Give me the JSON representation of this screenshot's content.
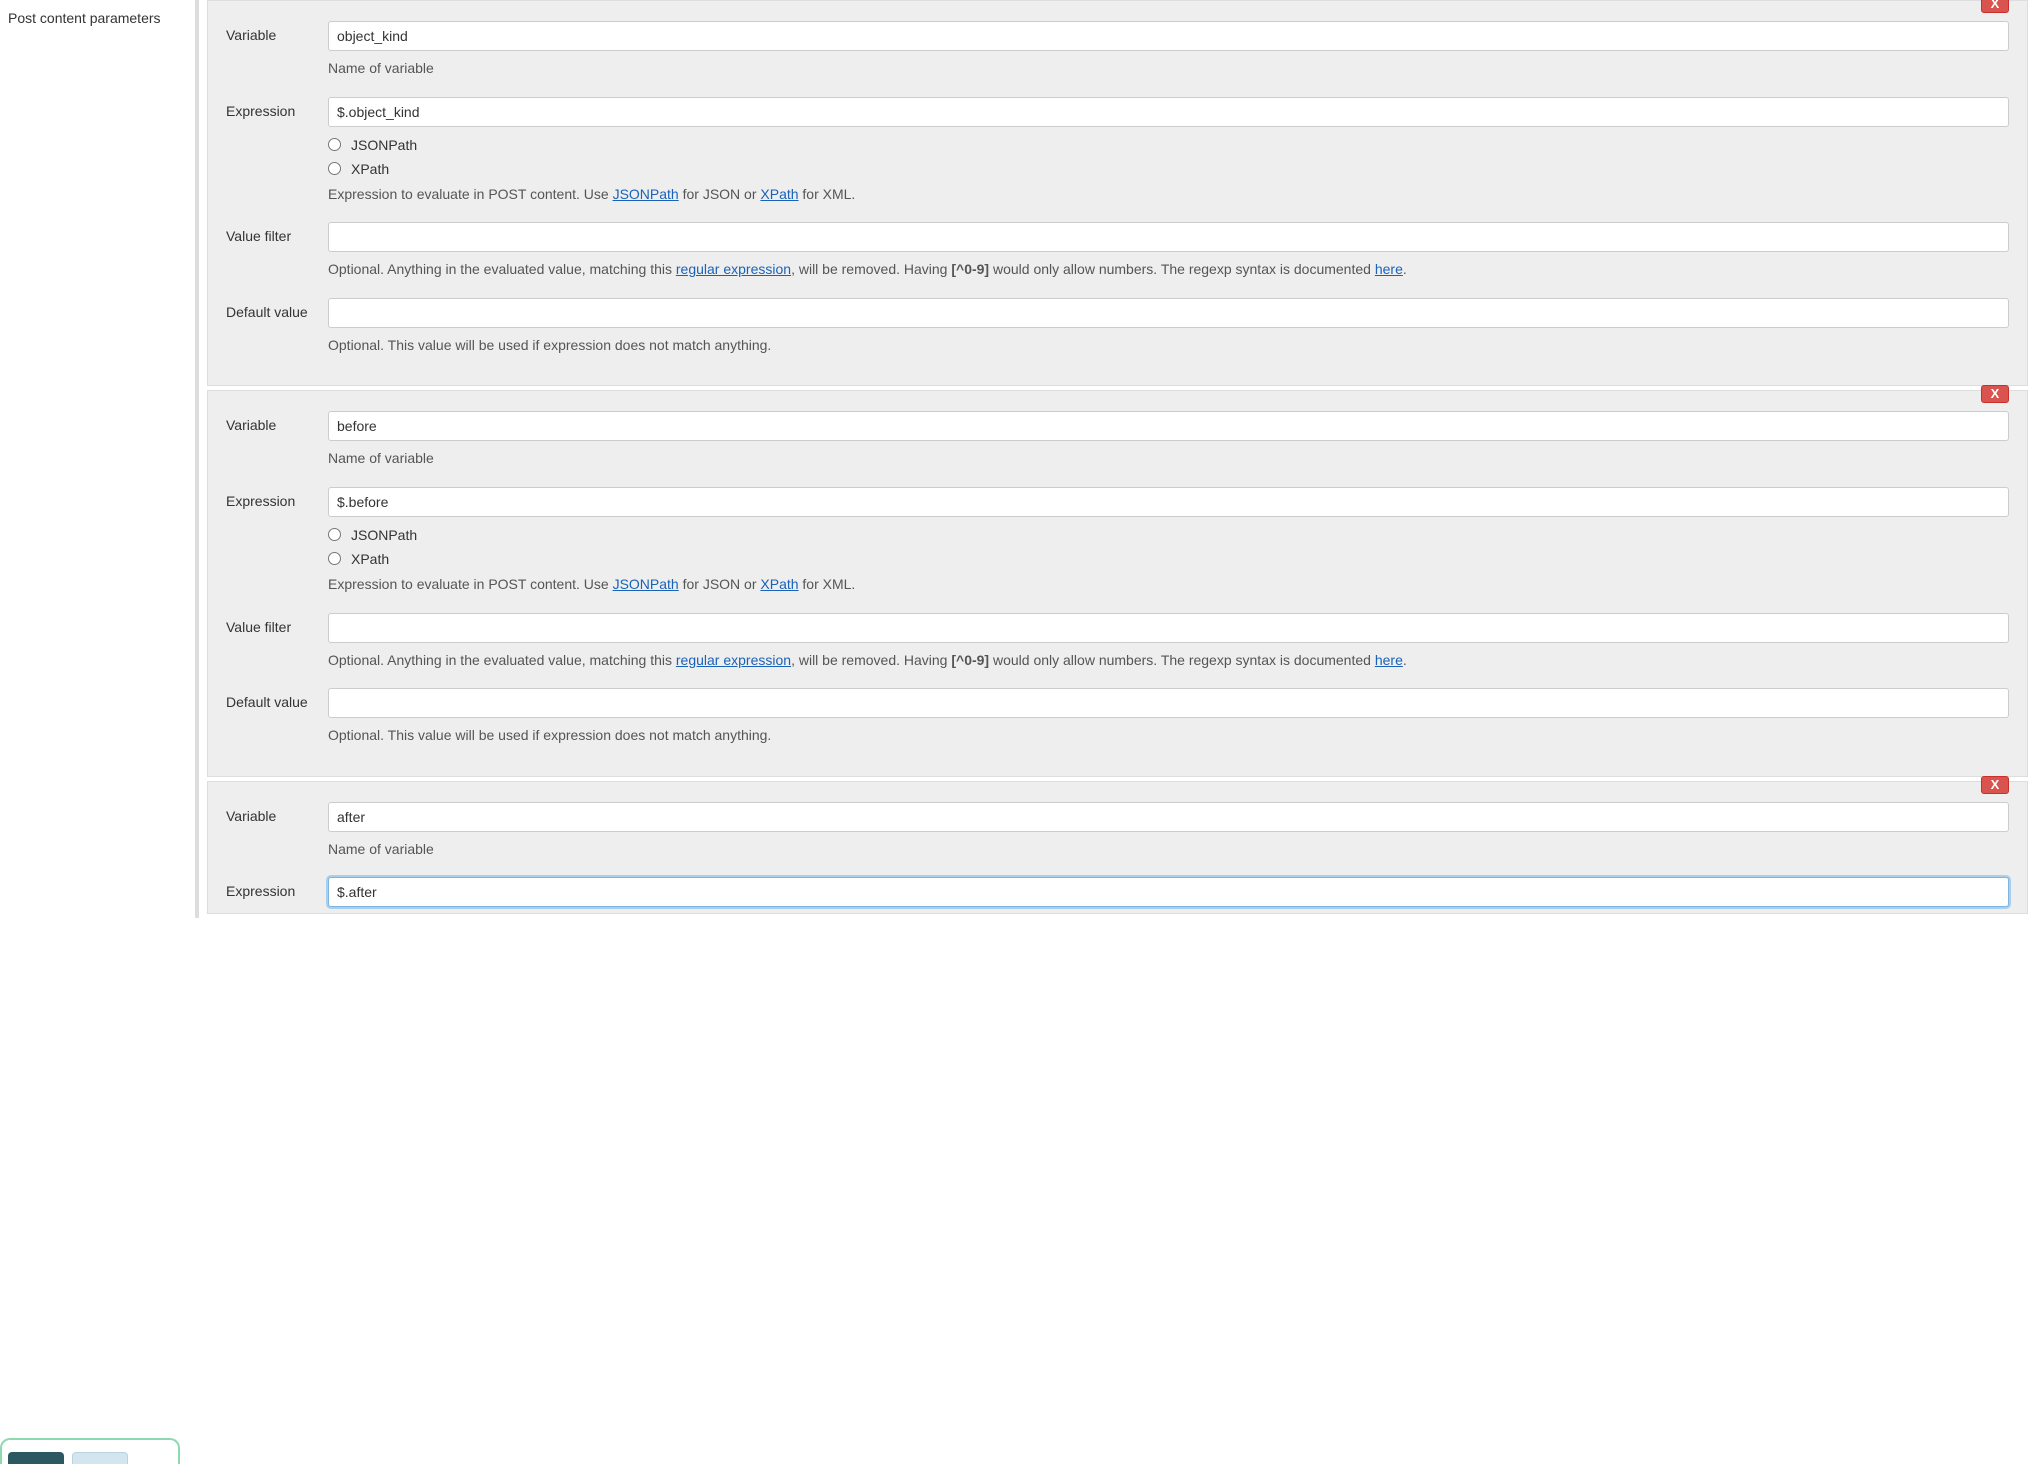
{
  "sidebar": {
    "section_label": "Post content parameters"
  },
  "common": {
    "close_label": "X",
    "labels": {
      "variable": "Variable",
      "expression": "Expression",
      "value_filter": "Value filter",
      "default_value": "Default value"
    },
    "help": {
      "name_of_variable": "Name of variable",
      "expression_prefix": "Expression to evaluate in POST content. Use ",
      "expression_mid": " for JSON or ",
      "expression_suffix": " for XML.",
      "jsonpath_link": "JSONPath",
      "xpath_link": "XPath",
      "value_filter_prefix": "Optional. Anything in the evaluated value, matching this ",
      "regex_link": "regular expression",
      "value_filter_mid": ", will be removed. Having ",
      "regex_example": "[^0-9]",
      "value_filter_suffix": " would only allow numbers. The regexp syntax is documented ",
      "here_link": "here",
      "period": ".",
      "default_value": "Optional. This value will be used if expression does not match anything."
    },
    "radio": {
      "jsonpath": "JSONPath",
      "xpath": "XPath"
    }
  },
  "params": [
    {
      "variable": "object_kind",
      "expression": "$.object_kind",
      "value_filter": "",
      "default_value": ""
    },
    {
      "variable": "before",
      "expression": "$.before",
      "value_filter": "",
      "default_value": ""
    },
    {
      "variable": "after",
      "expression": "$.after",
      "value_filter": "",
      "default_value": ""
    }
  ]
}
